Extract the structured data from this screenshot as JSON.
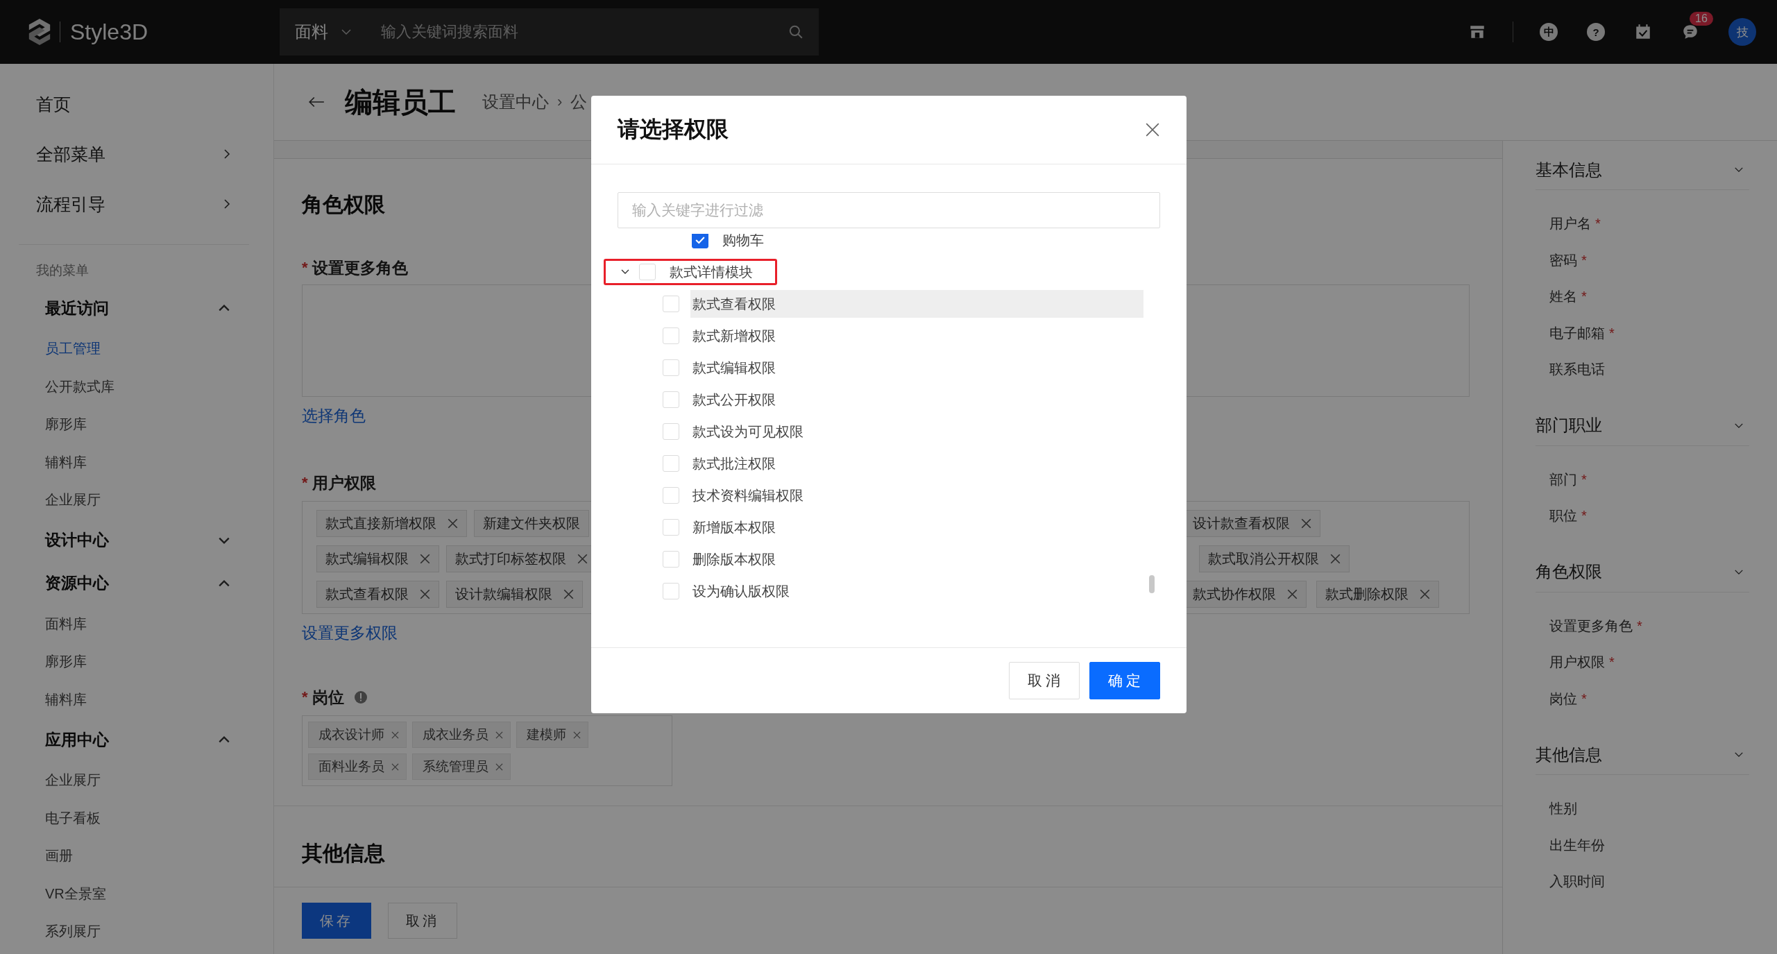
{
  "topbar": {
    "logo_text": "Style3D",
    "search": {
      "category": "面料",
      "placeholder": "输入关键词搜索面料"
    },
    "language": "中",
    "help": "?",
    "badge": "16",
    "avatar": "技"
  },
  "sidebar": {
    "top_items": [
      {
        "label": "首页",
        "arrow": false
      },
      {
        "label": "全部菜单",
        "arrow": true
      },
      {
        "label": "流程引导",
        "arrow": true
      }
    ],
    "section_label": "我的菜单",
    "groups": [
      {
        "title": "最近访问",
        "expanded": true,
        "items": [
          {
            "label": "员工管理",
            "selected": true
          },
          {
            "label": "公开款式库",
            "selected": false
          },
          {
            "label": "廓形库",
            "selected": false
          },
          {
            "label": "辅料库",
            "selected": false
          },
          {
            "label": "企业展厅",
            "selected": false
          }
        ]
      },
      {
        "title": "设计中心",
        "expanded": false
      },
      {
        "title": "资源中心",
        "expanded": true,
        "items": [
          {
            "label": "面料库",
            "selected": false
          },
          {
            "label": "廓形库",
            "selected": false
          },
          {
            "label": "辅料库",
            "selected": false
          }
        ]
      },
      {
        "title": "应用中心",
        "expanded": true,
        "items": [
          {
            "label": "企业展厅",
            "selected": false
          },
          {
            "label": "电子看板",
            "selected": false
          },
          {
            "label": "画册",
            "selected": false
          },
          {
            "label": "VR全景室",
            "selected": false
          },
          {
            "label": "系列展厅",
            "selected": false
          }
        ]
      }
    ]
  },
  "header": {
    "title": "编辑员工",
    "breadcrumb": [
      "设置中心",
      "公"
    ],
    "breadcrumb_separator": "›"
  },
  "form": {
    "section_title": "角色权限",
    "roles": {
      "label": "设置更多角色",
      "required_mark": "*",
      "link": "选择角色"
    },
    "permissions": {
      "label": "用户权限",
      "required_mark": "*",
      "link": "设置更多权限",
      "tag_rows": [
        {
          "left": [
            {
              "label": "款式直接新增权限",
              "close_icon": true
            },
            {
              "label": "新建文件夹权限",
              "close_icon": false
            }
          ],
          "right": [
            "设计款查看权限"
          ]
        },
        {
          "left": [
            {
              "label": "款式编辑权限",
              "close_icon": true
            },
            {
              "label": "款式打印标签权限",
              "close_icon": true
            }
          ],
          "right": [
            "款式取消公开权限"
          ]
        },
        {
          "left": [
            {
              "label": "款式查看权限",
              "close_icon": true
            },
            {
              "label": "设计款编辑权限",
              "close_icon": true
            }
          ],
          "right": [
            "款式协作权限",
            "款式删除权限"
          ]
        }
      ]
    },
    "positions": {
      "label": "岗位",
      "required_mark": "*",
      "tags": [
        "成衣设计师",
        "成衣业务员",
        "建模师",
        "面料业务员",
        "系统管理员"
      ]
    },
    "other_title": "其他信息",
    "buttons": {
      "save": "保存",
      "cancel": "取消"
    }
  },
  "outline": [
    {
      "title": "基本信息",
      "items": [
        {
          "label": "用户名",
          "required_mark": "*"
        },
        {
          "label": "密码",
          "required_mark": "*"
        },
        {
          "label": "姓名",
          "required_mark": "*"
        },
        {
          "label": "电子邮箱",
          "required_mark": "*"
        },
        {
          "label": "联系电话"
        }
      ]
    },
    {
      "title": "部门职业",
      "items": [
        {
          "label": "部门",
          "required_mark": "*"
        },
        {
          "label": "职位",
          "required_mark": "*"
        }
      ]
    },
    {
      "title": "角色权限",
      "items": [
        {
          "label": "设置更多角色",
          "required_mark": "*"
        },
        {
          "label": "用户权限",
          "required_mark": "*"
        },
        {
          "label": "岗位",
          "required_mark": "*"
        }
      ]
    },
    {
      "title": "其他信息",
      "items": [
        {
          "label": "性别"
        },
        {
          "label": "出生年份"
        },
        {
          "label": "入职时间"
        }
      ]
    }
  ],
  "dialog": {
    "title": "请选择权限",
    "filter": {
      "placeholder": "输入关键字进行过滤"
    },
    "tree": {
      "above": [
        {
          "label": "购物车",
          "checked": true
        }
      ],
      "nodes": [
        {
          "label": "款式详情模块",
          "checked": false,
          "expanded": true,
          "outlined": true,
          "children": [
            {
              "label": "款式查看权限",
              "checked": false,
              "hovered": true
            },
            {
              "label": "款式新增权限",
              "checked": false,
              "hovered": false
            },
            {
              "label": "款式编辑权限",
              "checked": false,
              "hovered": false
            },
            {
              "label": "款式公开权限",
              "checked": false,
              "hovered": false
            },
            {
              "label": "款式设为可见权限",
              "checked": false,
              "hovered": false
            },
            {
              "label": "款式批注权限",
              "checked": false,
              "hovered": false
            },
            {
              "label": "技术资料编辑权限",
              "checked": false,
              "hovered": false
            },
            {
              "label": "新增版本权限",
              "checked": false,
              "hovered": false
            },
            {
              "label": "删除版本权限",
              "checked": false,
              "hovered": false
            },
            {
              "label": "设为确认版权限",
              "checked": false,
              "hovered": false
            }
          ]
        }
      ]
    },
    "buttons": {
      "cancel": "取 消",
      "ok": "确 定"
    }
  }
}
